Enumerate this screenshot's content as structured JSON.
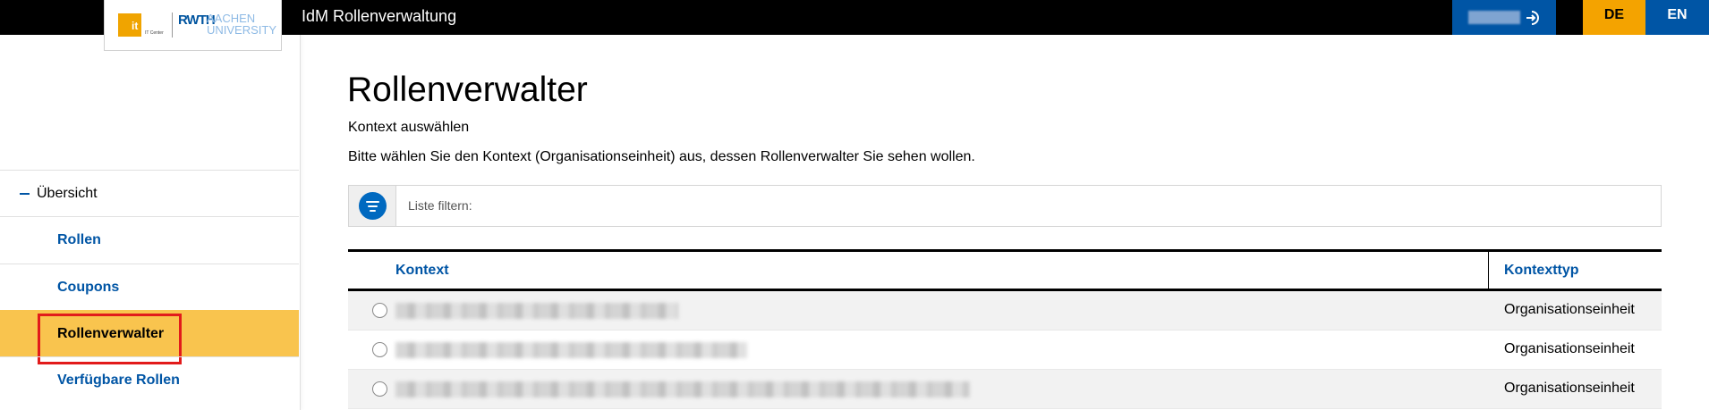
{
  "header": {
    "app_title": "IdM Rollenverwaltung",
    "logo": {
      "it_mark": "it",
      "it_center": "IT Center",
      "rwth": "RWTH",
      "aachen": "AACHEN",
      "university": "UNIVERSITY"
    },
    "user_button": {
      "icon": "login-icon"
    },
    "languages": [
      {
        "label": "DE",
        "active": true,
        "color": "#f4a300"
      },
      {
        "label": "EN",
        "active": false,
        "color": "#0055a5"
      }
    ]
  },
  "sidebar": {
    "overview_label": "Übersicht",
    "items": [
      {
        "label": "Rollen",
        "active": false
      },
      {
        "label": "Coupons",
        "active": false
      },
      {
        "label": "Rollenverwalter",
        "active": true
      },
      {
        "label": "Verfügbare Rollen",
        "active": false
      }
    ]
  },
  "main": {
    "title": "Rollenverwalter",
    "subtitle": "Kontext auswählen",
    "description": "Bitte wählen Sie den Kontext (Organisationseinheit) aus, dessen Rollenverwalter Sie sehen wollen.",
    "filter": {
      "label": "Liste filtern:",
      "icon": "filter-icon"
    },
    "table": {
      "columns": [
        "Kontext",
        "Kontexttyp"
      ],
      "rows": [
        {
          "context_redacted": true,
          "type": "Organisationseinheit"
        },
        {
          "context_redacted": true,
          "type": "Organisationseinheit"
        },
        {
          "context_redacted": true,
          "type": "Organisationseinheit"
        }
      ]
    }
  },
  "colors": {
    "primary_blue": "#0055a5",
    "accent_yellow": "#f4a300",
    "active_nav": "#f9c44e",
    "highlight_red": "#e21b1b"
  }
}
